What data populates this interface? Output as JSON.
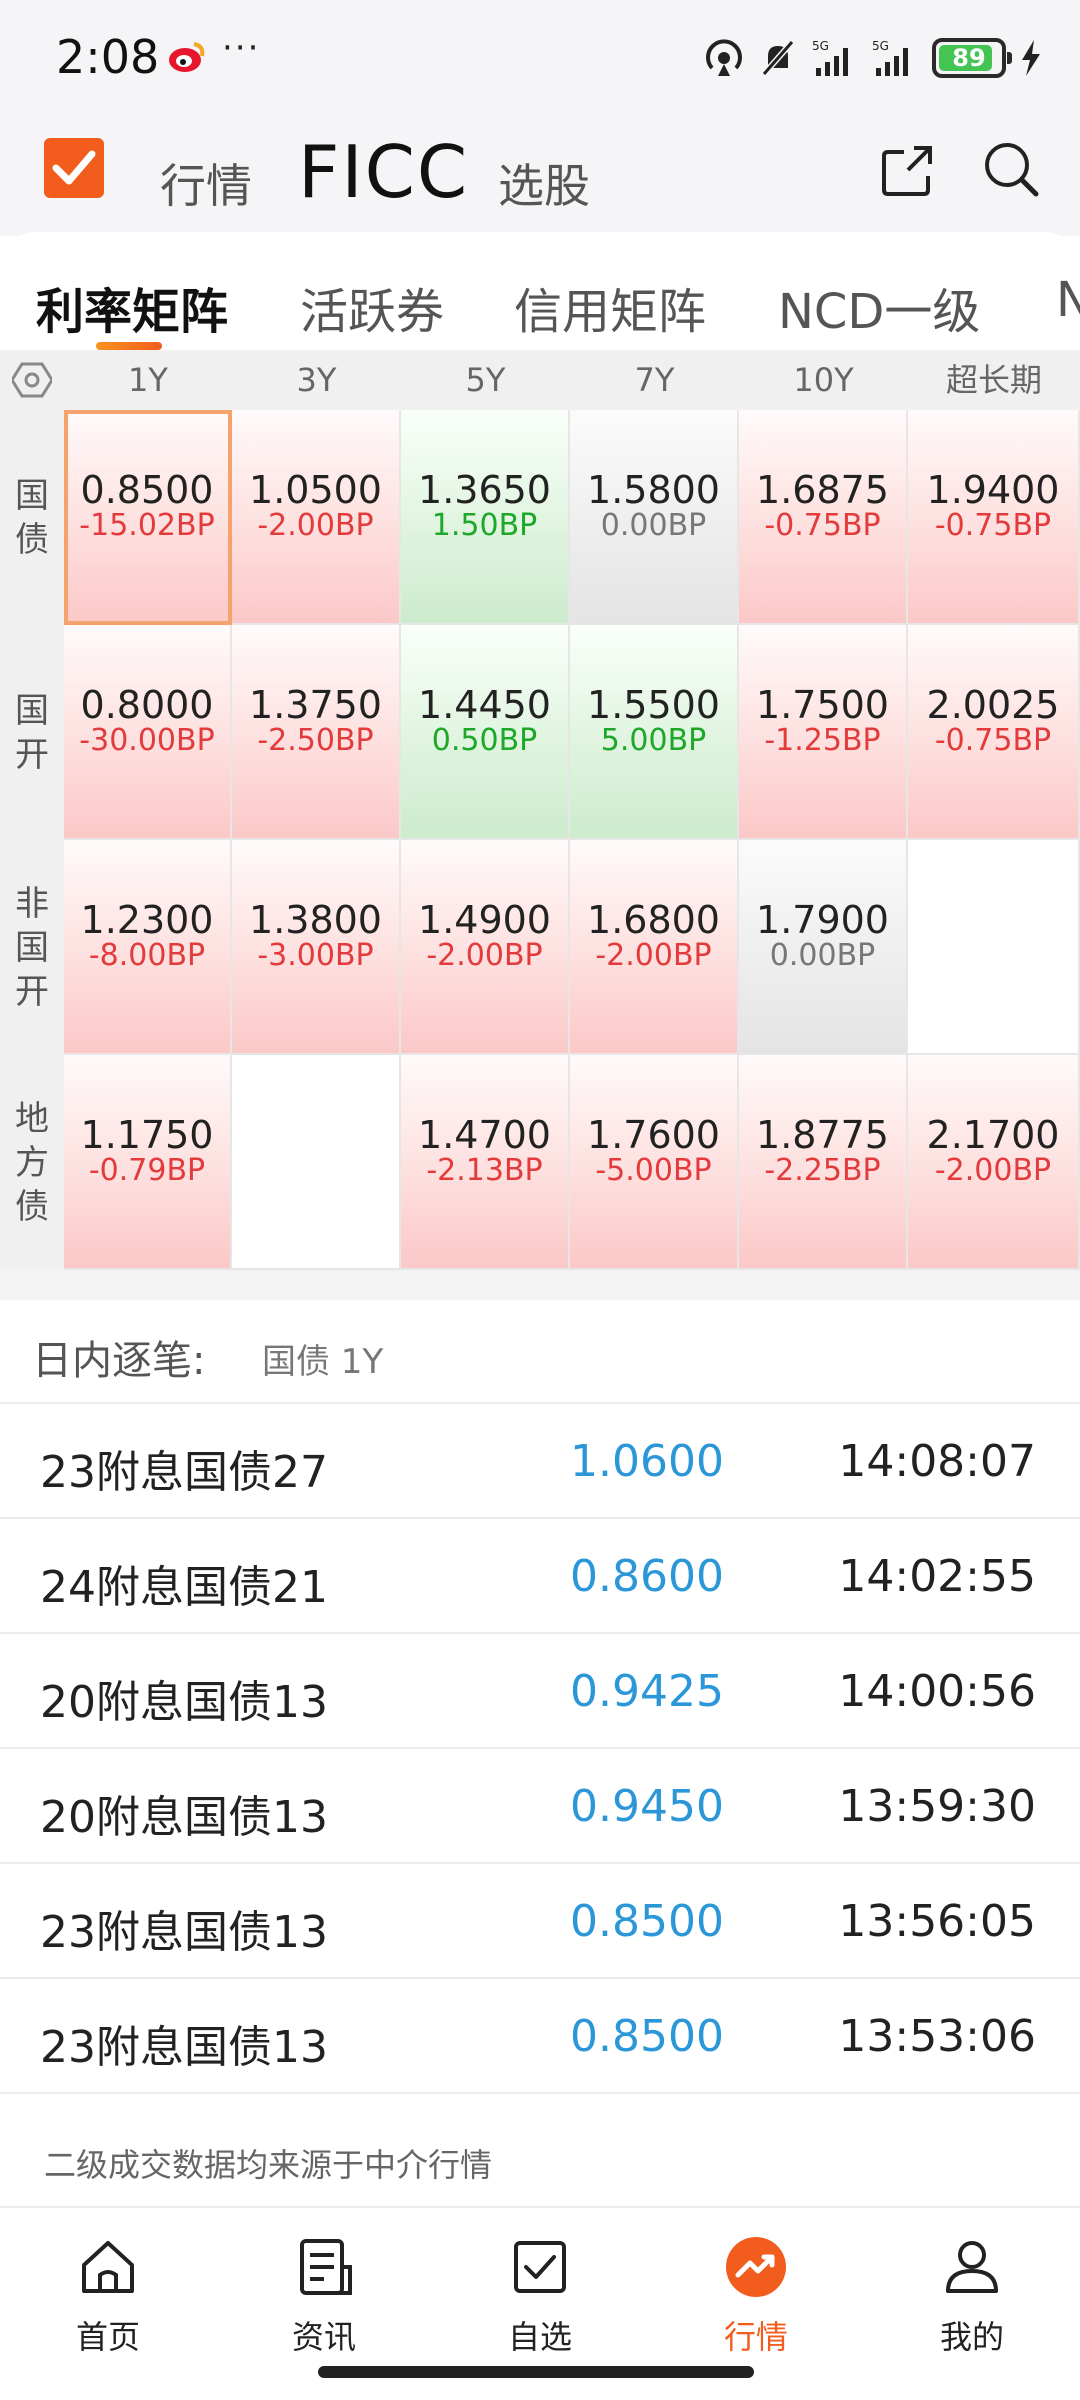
{
  "status_bar": {
    "time": "2:08",
    "dots": "···",
    "signal1": "5G",
    "signal2": "5G",
    "battery": "89"
  },
  "header": {
    "nav_left": "行情",
    "nav_title": "FICC",
    "nav_right": "选股"
  },
  "tabs": [
    "利率矩阵",
    "活跃券",
    "信用矩阵",
    "NCD一级",
    "N"
  ],
  "matrix": {
    "columns": [
      "1Y",
      "3Y",
      "5Y",
      "7Y",
      "10Y",
      "超长期"
    ],
    "rows": [
      {
        "label": [
          "国",
          "债"
        ],
        "cells": [
          {
            "val": "0.8500",
            "chg": "-15.02BP",
            "tone": "red"
          },
          {
            "val": "1.0500",
            "chg": "-2.00BP",
            "tone": "red"
          },
          {
            "val": "1.3650",
            "chg": "1.50BP",
            "tone": "green"
          },
          {
            "val": "1.5800",
            "chg": "0.00BP",
            "tone": "gray"
          },
          {
            "val": "1.6875",
            "chg": "-0.75BP",
            "tone": "red"
          },
          {
            "val": "1.9400",
            "chg": "-0.75BP",
            "tone": "red"
          }
        ]
      },
      {
        "label": [
          "国",
          "开"
        ],
        "cells": [
          {
            "val": "0.8000",
            "chg": "-30.00BP",
            "tone": "red"
          },
          {
            "val": "1.3750",
            "chg": "-2.50BP",
            "tone": "red"
          },
          {
            "val": "1.4450",
            "chg": "0.50BP",
            "tone": "green"
          },
          {
            "val": "1.5500",
            "chg": "5.00BP",
            "tone": "green"
          },
          {
            "val": "1.7500",
            "chg": "-1.25BP",
            "tone": "red"
          },
          {
            "val": "2.0025",
            "chg": "-0.75BP",
            "tone": "red"
          }
        ]
      },
      {
        "label": [
          "非",
          "国",
          "开"
        ],
        "cells": [
          {
            "val": "1.2300",
            "chg": "-8.00BP",
            "tone": "red"
          },
          {
            "val": "1.3800",
            "chg": "-3.00BP",
            "tone": "red"
          },
          {
            "val": "1.4900",
            "chg": "-2.00BP",
            "tone": "red"
          },
          {
            "val": "1.6800",
            "chg": "-2.00BP",
            "tone": "red"
          },
          {
            "val": "1.7900",
            "chg": "0.00BP",
            "tone": "gray"
          },
          {
            "val": "",
            "chg": "",
            "tone": "empty"
          }
        ]
      },
      {
        "label": [
          "地",
          "方",
          "债"
        ],
        "cells": [
          {
            "val": "1.1750",
            "chg": "-0.79BP",
            "tone": "red"
          },
          {
            "val": "",
            "chg": "",
            "tone": "empty"
          },
          {
            "val": "1.4700",
            "chg": "-2.13BP",
            "tone": "red"
          },
          {
            "val": "1.7600",
            "chg": "-5.00BP",
            "tone": "red"
          },
          {
            "val": "1.8775",
            "chg": "-2.25BP",
            "tone": "red"
          },
          {
            "val": "2.1700",
            "chg": "-2.00BP",
            "tone": "red"
          }
        ]
      }
    ]
  },
  "intraday": {
    "title": "日内逐笔:",
    "selected": "国债 1Y",
    "rows": [
      {
        "name": "23附息国债27",
        "price": "1.0600",
        "time": "14:08:07"
      },
      {
        "name": "24附息国债21",
        "price": "0.8600",
        "time": "14:02:55"
      },
      {
        "name": "20附息国债13",
        "price": "0.9425",
        "time": "14:00:56"
      },
      {
        "name": "20附息国债13",
        "price": "0.9450",
        "time": "13:59:30"
      },
      {
        "name": "23附息国债13",
        "price": "0.8500",
        "time": "13:56:05"
      },
      {
        "name": "23附息国债13",
        "price": "0.8500",
        "time": "13:53:06"
      }
    ]
  },
  "footnote": "二级成交数据均来源于中介行情",
  "bottom_nav": [
    {
      "label": "首页",
      "icon": "home-icon",
      "active": false
    },
    {
      "label": "资讯",
      "icon": "news-icon",
      "active": false
    },
    {
      "label": "自选",
      "icon": "watchlist-icon",
      "active": false
    },
    {
      "label": "行情",
      "icon": "market-icon",
      "active": true
    },
    {
      "label": "我的",
      "icon": "profile-icon",
      "active": false
    }
  ],
  "colors": {
    "accent": "#f25c1d",
    "up": "#e33b3b",
    "down": "#1ea82a",
    "price": "#2b97d8"
  }
}
